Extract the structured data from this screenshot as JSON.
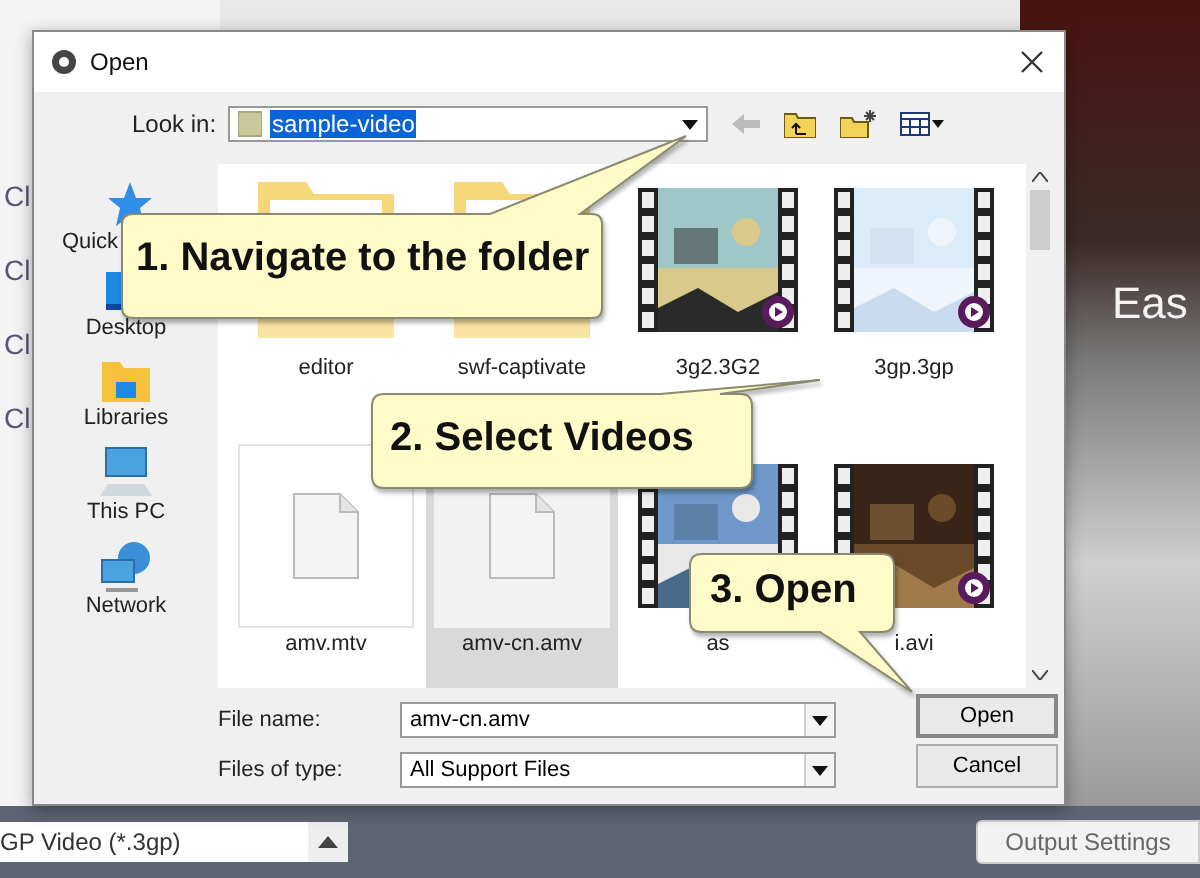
{
  "background_app": {
    "side_labels": [
      "Cl",
      "Cl",
      "Cl",
      "Cl"
    ],
    "banner_text": "Eas",
    "format_field": "GP Video (*.3gp)",
    "output_button": "Output Settings"
  },
  "dialog": {
    "title": "Open",
    "look_in": {
      "label": "Look in:",
      "value": "sample-video"
    },
    "places": [
      {
        "label": "Quick",
        "kind": "star"
      },
      {
        "label": "Desktop",
        "kind": "desktop"
      },
      {
        "label": "Libraries",
        "kind": "library"
      },
      {
        "label": "This PC",
        "kind": "pc"
      },
      {
        "label": "Network",
        "kind": "network"
      }
    ],
    "files": [
      {
        "name": "editor",
        "kind": "folder",
        "selected": false
      },
      {
        "name": "swf-captivate",
        "kind": "folder",
        "selected": false
      },
      {
        "name": "3g2.3G2",
        "kind": "video",
        "selected": false,
        "badge": true
      },
      {
        "name": "3gp.3gp",
        "kind": "video",
        "selected": false,
        "badge": true
      },
      {
        "name": "amv.mtv",
        "kind": "document",
        "selected": false
      },
      {
        "name": "amv-cn.amv",
        "kind": "document",
        "selected": true
      },
      {
        "name": "as",
        "kind": "video",
        "selected": false,
        "badge": false
      },
      {
        "name": "i.avi",
        "kind": "video",
        "selected": false,
        "badge": true
      }
    ],
    "file_name": {
      "label": "File name:",
      "value": "amv-cn.amv"
    },
    "file_type": {
      "label": "Files of type:",
      "value": "All Support Files"
    },
    "buttons": [
      "Open",
      "Cancel"
    ]
  },
  "callouts": [
    {
      "text": "1. Navigate to the folder"
    },
    {
      "text": "2. Select Videos"
    },
    {
      "text": "3. Open"
    }
  ]
}
